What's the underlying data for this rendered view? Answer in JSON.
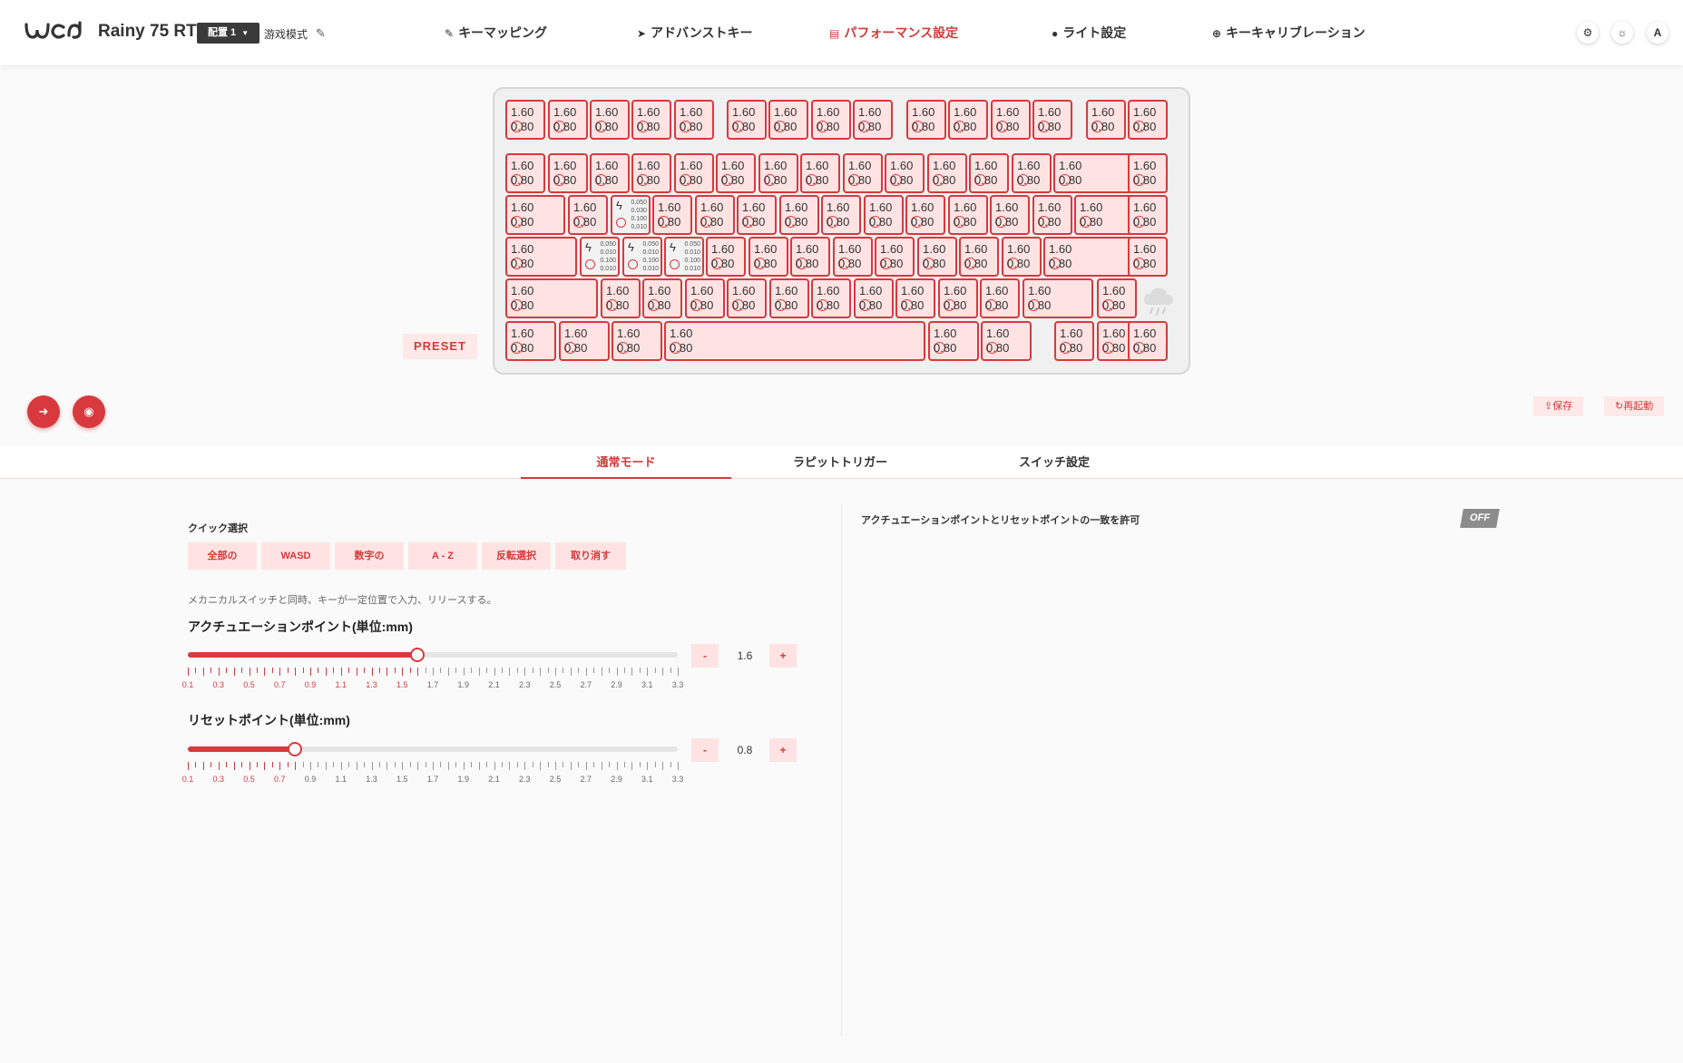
{
  "header": {
    "device_name": "Rainy 75 RT",
    "layout_select": "配置 1",
    "game_mode": "游戏模式",
    "nav": [
      {
        "label": "キーマッピング",
        "icon": "pencil-icon"
      },
      {
        "label": "アドバンストキー",
        "icon": "send-icon"
      },
      {
        "label": "パフォーマンス設定",
        "icon": "chart-icon",
        "active": true
      },
      {
        "label": "ライト設定",
        "icon": "bulb-icon"
      },
      {
        "label": "キーキャリブレーション",
        "icon": "crosshair-icon"
      }
    ],
    "right_buttons": [
      {
        "icon": "gear-icon",
        "glyph": "⚙"
      },
      {
        "icon": "sun-icon",
        "glyph": "☼"
      },
      {
        "icon": "language-icon",
        "glyph": "A"
      }
    ]
  },
  "keyboard": {
    "key_top": "1.60",
    "key_bottom": "0.80",
    "rt_values": [
      "0.050",
      "0.030",
      "0.100",
      "0.010"
    ],
    "rt_values_alt": [
      "0.050",
      "0.010",
      "0.100",
      "0.010"
    ]
  },
  "preset_label": "PRESET",
  "actions": {
    "save": "保存",
    "restart": "再起動"
  },
  "tabs": [
    {
      "label": "通常モード",
      "active": true
    },
    {
      "label": "ラピットトリガー"
    },
    {
      "label": "スイッチ設定"
    }
  ],
  "quick": {
    "title": "クイック選択",
    "buttons": [
      "全部の",
      "WASD",
      "数字の",
      "A - Z",
      "反転選択",
      "取り消す"
    ]
  },
  "description": "メカニカルスイッチと同時、キーが一定位置で入力、リリースする。",
  "actuation": {
    "title": "アクチュエーションポイント(単位:mm)",
    "value": "1.6",
    "value_num": 1.6
  },
  "reset": {
    "title": "リセットポイント(単位:mm)",
    "value": "0.8",
    "value_num": 0.8
  },
  "scale": {
    "min": 0.1,
    "max": 3.3,
    "labels": [
      "0.1",
      "0.3",
      "0.5",
      "0.7",
      "0.9",
      "1.1",
      "1.3",
      "1.5",
      "1.7",
      "1.9",
      "2.1",
      "2.3",
      "2.5",
      "2.7",
      "2.9",
      "3.1",
      "3.3"
    ]
  },
  "stepper": {
    "minus": "-",
    "plus": "+"
  },
  "allow_match": {
    "label": "アクチュエーションポイントとリセットポイントの一致を許可",
    "state": "OFF"
  },
  "colors": {
    "accent": "#d8393e",
    "key_fill": "#ffe3e3"
  }
}
